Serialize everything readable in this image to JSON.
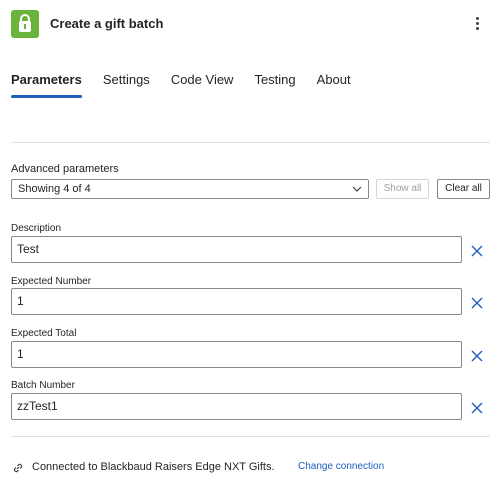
{
  "header": {
    "title": "Create a gift batch",
    "app_icon": "gift-lock-icon",
    "more_icon": "more-vertical-icon",
    "accent": "#6bb33a"
  },
  "tabs": [
    {
      "label": "Parameters",
      "active": true
    },
    {
      "label": "Settings",
      "active": false
    },
    {
      "label": "Code View",
      "active": false
    },
    {
      "label": "Testing",
      "active": false
    },
    {
      "label": "About",
      "active": false
    }
  ],
  "advanced": {
    "label": "Advanced parameters",
    "select_value": "Showing 4 of 4",
    "show_all_label": "Show all",
    "clear_all_label": "Clear all"
  },
  "fields": [
    {
      "label": "Description",
      "value": "Test"
    },
    {
      "label": "Expected Number",
      "value": "1"
    },
    {
      "label": "Expected Total",
      "value": "1"
    },
    {
      "label": "Batch Number",
      "value": "zzTest1"
    }
  ],
  "connection": {
    "text": "Connected to Blackbaud Raisers Edge NXT Gifts.",
    "link_label": "Change connection",
    "icon": "link-icon",
    "link_color": "#1f5fbd"
  }
}
